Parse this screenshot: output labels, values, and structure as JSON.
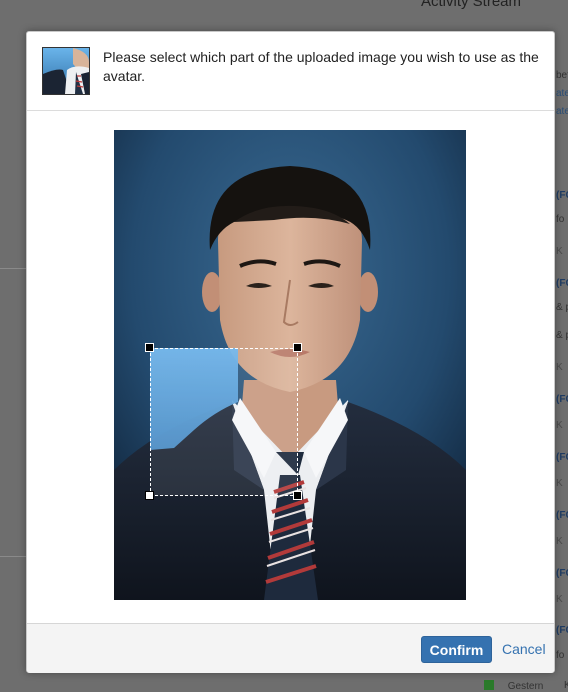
{
  "background": {
    "title": "Activity Stream",
    "right_texts": [
      {
        "text": "befor",
        "style": "dark"
      },
      {
        "text": "ate v",
        "style": "link"
      },
      {
        "text": "ate v",
        "style": "link"
      },
      {
        "text": "(FC",
        "style": "bold"
      },
      {
        "text": "fo",
        "style": "dark"
      },
      {
        "text": "K",
        "style": "gray"
      },
      {
        "text": "(FC",
        "style": "bold"
      },
      {
        "text": "& p",
        "style": "dark"
      },
      {
        "text": "& p",
        "style": "dark"
      },
      {
        "text": "K",
        "style": "gray"
      },
      {
        "text": "(FC",
        "style": "bold"
      },
      {
        "text": "K",
        "style": "gray"
      },
      {
        "text": "(FC",
        "style": "bold"
      },
      {
        "text": "K",
        "style": "gray"
      },
      {
        "text": "(FC",
        "style": "bold"
      },
      {
        "text": "K",
        "style": "gray"
      },
      {
        "text": "(FC",
        "style": "bold"
      },
      {
        "text": "K",
        "style": "gray"
      },
      {
        "text": "(FC",
        "style": "bold"
      },
      {
        "text": "fo",
        "style": "dark"
      }
    ],
    "footer_label": "Gestern",
    "footer_k": "K"
  },
  "dialog": {
    "message": "Please select which part of the uploaded image you wish to use as the avatar.",
    "confirm_label": "Confirm",
    "cancel_label": "Cancel"
  },
  "colors": {
    "accent": "#3572b0",
    "photo_background": "#2b4e70",
    "suit": "#1a2231",
    "tie_stripe": "#b23a3a"
  }
}
